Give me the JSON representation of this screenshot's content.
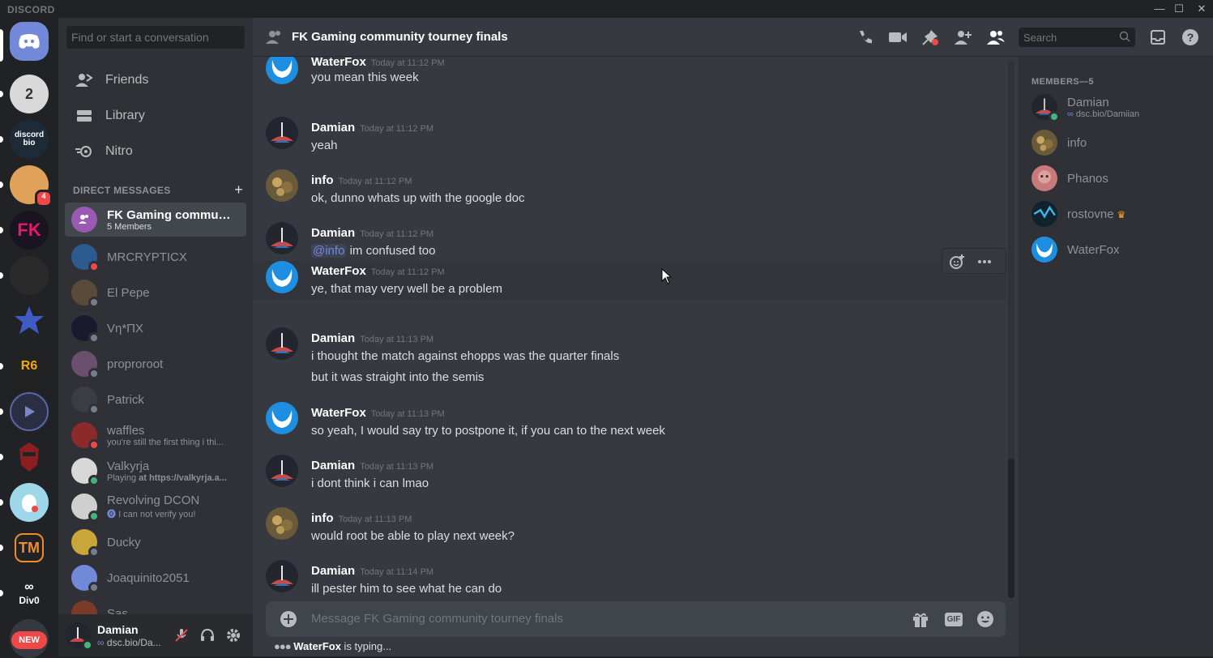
{
  "window": {
    "brand": "DISCORD",
    "controls": [
      "—",
      "☐",
      "✕"
    ]
  },
  "servers": {
    "badge_count": "4",
    "new_label": "NEW",
    "items": [
      "discord",
      "2",
      "discord bio",
      "",
      "FK",
      "",
      "",
      "R6",
      "",
      "",
      "",
      "TM",
      "Div0"
    ]
  },
  "dm_sidebar": {
    "search_placeholder": "Find or start a conversation",
    "nav": [
      {
        "label": "Friends",
        "icon": "friends-icon"
      },
      {
        "label": "Library",
        "icon": "library-icon"
      },
      {
        "label": "Nitro",
        "icon": "nitro-icon"
      }
    ],
    "section_title": "DIRECT MESSAGES",
    "dms": [
      {
        "name": "FK Gaming communi...",
        "sub": "5 Members",
        "color": "#9b59b6",
        "status": ""
      },
      {
        "name": "MRCRYPTICX",
        "sub": "",
        "color": "#2c5b8f",
        "status": "#f04747"
      },
      {
        "name": "El Pepe",
        "sub": "",
        "color": "#5a4a3a",
        "status": "#747f8d"
      },
      {
        "name": "Vη*ΠX",
        "sub": "",
        "color": "#1a1a2e",
        "status": "#747f8d"
      },
      {
        "name": "proproroot",
        "sub": "",
        "color": "#6a4f6f",
        "status": "#747f8d"
      },
      {
        "name": "Patrick",
        "sub": "",
        "color": "#3a3d42",
        "status": "#747f8d"
      },
      {
        "name": "waffles",
        "sub": "you're still the first thing i thi...",
        "color": "#8b2a2a",
        "status": "#f04747"
      },
      {
        "name": "Valkyrja",
        "sub_prefix": "Playing ",
        "sub": "at https://valkyrja.a...",
        "color": "#d8d8d8",
        "status": "#43b581"
      },
      {
        "name": "Revolving DCON",
        "sub": "I can not verify you!",
        "color": "#cfcfcf",
        "status": "#43b581"
      },
      {
        "name": "Ducky",
        "sub": "",
        "color": "#c8a63a",
        "status": "#747f8d"
      },
      {
        "name": "Joaquinito2051",
        "sub": "",
        "color": "#7289da",
        "status": "#747f8d"
      },
      {
        "name": "Sas",
        "sub": "",
        "color": "#7a3a2a",
        "status": ""
      }
    ],
    "user": {
      "name": "Damian",
      "status": "dsc.bio/Da..."
    }
  },
  "channel": {
    "title": "FK Gaming community tourney finals",
    "search_placeholder": "Search",
    "composer_placeholder": "Message FK Gaming community tourney finals",
    "gif_label": "GIF",
    "typing_user": "WaterFox",
    "typing_suffix": " is typing..."
  },
  "messages": [
    {
      "author": "WaterFox",
      "ts": "Today at 11:12 PM",
      "lines": [
        "you mean this week"
      ],
      "avatar": "waterfox"
    },
    {
      "author": "Damian",
      "ts": "Today at 11:12 PM",
      "lines": [
        "yeah"
      ],
      "avatar": "damian"
    },
    {
      "author": "info",
      "ts": "Today at 11:12 PM",
      "lines": [
        "ok, dunno whats up with the google doc"
      ],
      "avatar": "info"
    },
    {
      "author": "Damian",
      "ts": "Today at 11:12 PM",
      "mention": "@info",
      "lines": [
        " im confused too"
      ],
      "avatar": "damian"
    },
    {
      "author": "WaterFox",
      "ts": "Today at 11:12 PM",
      "lines": [
        "ye, that may very well be a problem"
      ],
      "avatar": "waterfox"
    },
    {
      "author": "Damian",
      "ts": "Today at 11:13 PM",
      "lines": [
        "i thought the match against ehopps was the quarter finals",
        "but it was straight into the semis"
      ],
      "avatar": "damian"
    },
    {
      "author": "WaterFox",
      "ts": "Today at 11:13 PM",
      "lines": [
        "so yeah, I would say try to postpone it, if you can to the next week"
      ],
      "avatar": "waterfox"
    },
    {
      "author": "Damian",
      "ts": "Today at 11:13 PM",
      "lines": [
        "i dont think i can lmao"
      ],
      "avatar": "damian"
    },
    {
      "author": "info",
      "ts": "Today at 11:13 PM",
      "lines": [
        "would root be able to play next week?"
      ],
      "avatar": "info"
    },
    {
      "author": "Damian",
      "ts": "Today at 11:14 PM",
      "lines": [
        "ill pester him to see what he can do"
      ],
      "avatar": "damian"
    }
  ],
  "members": {
    "header": "MEMBERS—5",
    "list": [
      {
        "name": "Damian",
        "sub": "dsc.bio/Damiian",
        "avatar": "damian",
        "crown": false
      },
      {
        "name": "info",
        "sub": "",
        "avatar": "info",
        "crown": false
      },
      {
        "name": "Phanos",
        "sub": "",
        "avatar": "phanos",
        "crown": false
      },
      {
        "name": "rostovne",
        "sub": "",
        "avatar": "rostovne",
        "crown": true
      },
      {
        "name": "WaterFox",
        "sub": "",
        "avatar": "waterfox",
        "crown": false
      }
    ]
  },
  "colors": {
    "blurple": "#7289da",
    "online": "#43b581",
    "dnd": "#f04747",
    "offline": "#747f8d"
  }
}
